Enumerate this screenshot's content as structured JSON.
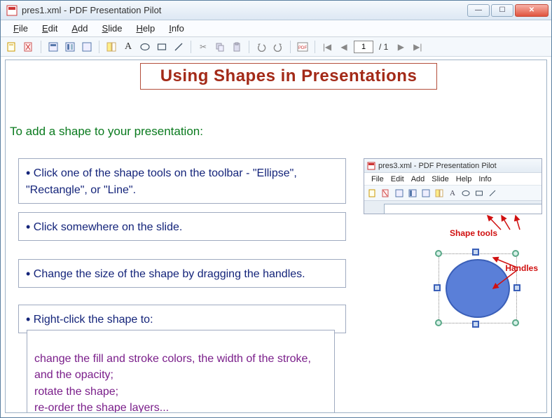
{
  "window": {
    "title": "pres1.xml - PDF Presentation Pilot",
    "menu": {
      "file": "File",
      "edit": "Edit",
      "add": "Add",
      "slide": "Slide",
      "help": "Help",
      "info": "Info"
    },
    "page_current": "1",
    "page_total": "/ 1"
  },
  "slide": {
    "title": "Using Shapes in Presentations",
    "intro": "To add a shape to your presentation:",
    "b1": "Click one of the shape tools on the toolbar - \"Ellipse\", \"Rectangle\", or \"Line\".",
    "b2": "Click somewhere on the slide.",
    "b3": "Change the size of the shape by dragging the handles.",
    "b4": "Right-click the shape to:",
    "sub": "change the fill and stroke colors, the width of the stroke, and the opacity;\nrotate the shape;\nre-order the shape layers..."
  },
  "embedded": {
    "title": "pres3.xml - PDF Presentation Pilot",
    "menu": {
      "file": "File",
      "edit": "Edit",
      "add": "Add",
      "slide": "Slide",
      "help": "Help",
      "info": "Info"
    }
  },
  "labels": {
    "shape_tools": "Shape tools",
    "handles": "Handles"
  }
}
